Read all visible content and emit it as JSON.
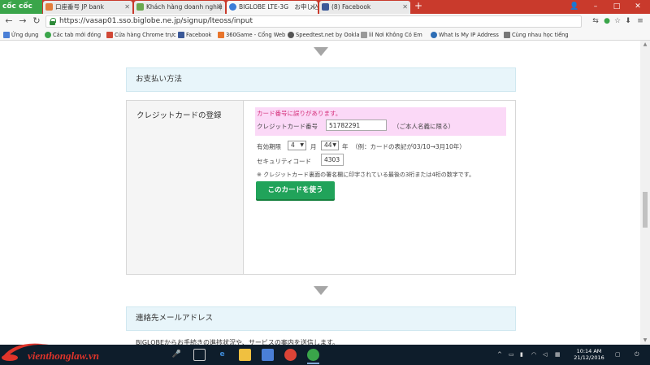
{
  "browser": {
    "brand": "cốc cốc",
    "tabs": [
      {
        "label": "口座番号 JP bank"
      },
      {
        "label": "Khách hàng doanh nghiệ"
      },
      {
        "label": "BIGLOBE LTE-3G　お申し込"
      },
      {
        "label": "(8) Facebook"
      }
    ],
    "url": "https://vasap01.sso.biglobe.ne.jp/signup/lteoss/input",
    "bookmarks": [
      {
        "label": "Ứng dụng"
      },
      {
        "label": "Các tab mới đóng"
      },
      {
        "label": "Cửa hàng Chrome trực"
      },
      {
        "label": "Facebook"
      },
      {
        "label": "360Game - Cổng Web"
      },
      {
        "label": "Speedtest.net by Ookla"
      },
      {
        "label": "lil Nơi Không Có Em"
      },
      {
        "label": "What Is My IP Address"
      },
      {
        "label": "Cùng nhau học tiếng"
      }
    ]
  },
  "page": {
    "payment_section_title": "お支払い方法",
    "credit_card_label": "クレジットカードの登録",
    "error_message": "カード番号に誤りがあります。",
    "card_number_label": "クレジットカード番号",
    "card_number_value": "51782291",
    "card_note": "（ご本人名義に限る）",
    "expiry_label": "有効期限",
    "expiry_month": "4",
    "expiry_month_unit": "月",
    "expiry_year": "44",
    "expiry_year_unit": "年",
    "expiry_example": "（例：カードの表記が03/10→3月10年）",
    "security_code_label": "セキュリティコード",
    "security_code_value": "4303",
    "security_note": "※ クレジットカード裏面の署名欄に印字されている最後の3桁または4桁の数字です。",
    "submit_label": "このカードを使う",
    "contact_section_title": "連絡先メールアドレス",
    "contact_text": "BIGLOBEからお手続きの進捗状況や、サービスの案内を送信します。"
  },
  "watermark": {
    "text": "vienthonglaw.vn"
  },
  "taskbar": {
    "time": "10:14 AM",
    "date": "21/12/2016"
  },
  "colors": {
    "tab_strip": "#c93a2c",
    "brand_green": "#3aa54a",
    "section_bg": "#e8f5fa",
    "error_bg": "#fbd9f7",
    "error_text": "#d5307a",
    "button_green": "#21a35a",
    "taskbar": "#0e1d2b"
  }
}
